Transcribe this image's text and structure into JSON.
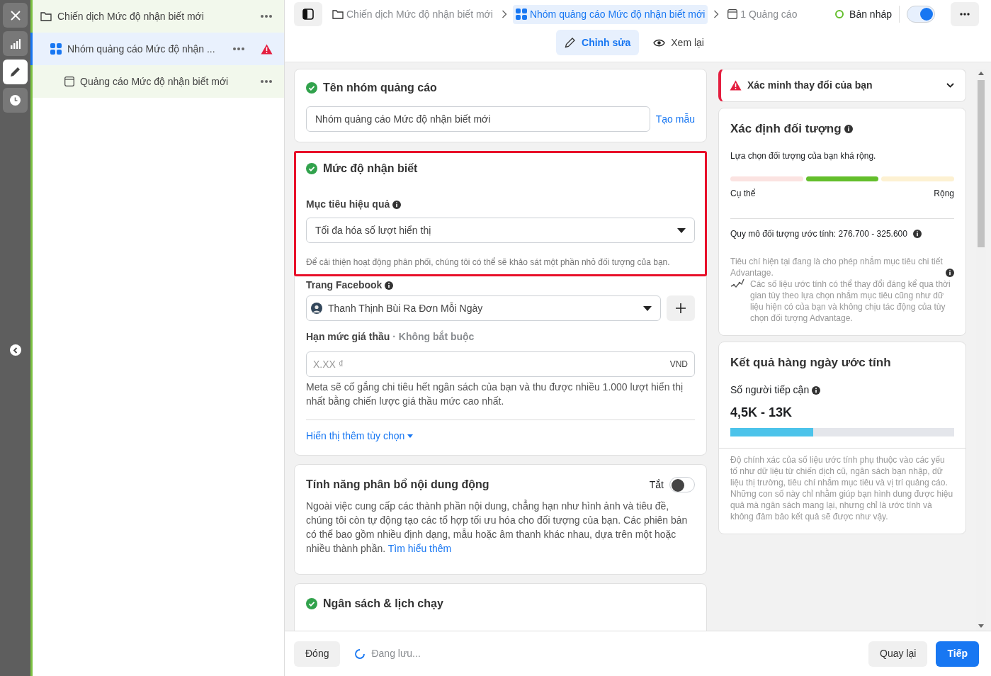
{
  "rail": {
    "buttons": [
      {
        "kind": "close",
        "selected": false
      },
      {
        "kind": "chart",
        "selected": false
      },
      {
        "kind": "edit",
        "selected": true
      },
      {
        "kind": "history",
        "selected": false
      }
    ]
  },
  "tree": [
    {
      "kind": "campaign",
      "label": "Chiến dịch Mức độ nhận biết mới",
      "selected": false,
      "warning": false,
      "children": [
        {
          "kind": "adset",
          "label": "Nhóm quảng cáo Mức độ nhận ...",
          "selected": true,
          "warning": true,
          "children": [
            {
              "kind": "ad",
              "label": "Quảng cáo Mức độ nhận biết mới",
              "selected": false,
              "warning": false
            }
          ]
        }
      ]
    }
  ],
  "breadcrumb": [
    {
      "kind": "campaign",
      "label": "Chiến dịch Mức độ nhận biết mới",
      "selected": false
    },
    {
      "kind": "adset",
      "label": "Nhóm quảng cáo Mức độ nhận biết mới",
      "selected": true
    },
    {
      "kind": "ad",
      "label": "1 Quảng cáo",
      "selected": false
    }
  ],
  "status": {
    "label": "Bản nháp",
    "on": true
  },
  "mode_tabs": [
    {
      "kind": "edit",
      "label": "Chỉnh sửa",
      "selected": true
    },
    {
      "kind": "review",
      "label": "Xem lại",
      "selected": false
    }
  ],
  "adset_name": {
    "title": "Tên nhóm quảng cáo",
    "complete": true,
    "value": "Nhóm quảng cáo Mức độ nhận biết mới",
    "link": "Tạo mẫu"
  },
  "awareness": {
    "title": "Mức độ nhận biết",
    "complete": true,
    "goal_label": "Mục tiêu hiệu quả",
    "goal_value": "Tối đa hóa số lượt hiển thị",
    "note": "Để cải thiện hoạt động phân phối, chúng tôi có thể sẽ khảo sát một phần nhỏ đối tượng của bạn.",
    "page_label": "Trang Facebook",
    "page_value": "Thanh Thịnh Bùi Ra Đơn Mỗi Ngày",
    "bid_label": "Hạn mức giá thầu",
    "bid_optional": "· Không bắt buộc",
    "bid_placeholder": "X.XX ₫",
    "bid_currency": "VND",
    "bid_help": "Meta sẽ cố gắng chi tiêu hết ngân sách của bạn và thu được nhiều 1.000 lượt hiển thị nhất bằng chiến lược giá thầu mức cao nhất.",
    "more_link": "Hiển thị thêm tùy chọn"
  },
  "dynamic_creative": {
    "title": "Tính năng phân bổ nội dung động",
    "state_label": "Tắt",
    "on": false,
    "text": "Ngoài việc cung cấp các thành phần nội dung, chẳng hạn như hình ảnh và tiêu đề, chúng tôi còn tự động tạo các tổ hợp tối ưu hóa cho đối tượng của bạn. Các phiên bản có thể bao gồm nhiều định dạng, mẫu hoặc âm thanh khác nhau, dựa trên một hoặc nhiều thành phần.",
    "link": "Tìm hiểu thêm"
  },
  "budget": {
    "title": "Ngân sách & lịch chạy",
    "complete": true
  },
  "alert": {
    "title": "Xác minh thay đổi của bạn",
    "expanded": false
  },
  "audience": {
    "title": "Xác định đối tượng",
    "summary": "Lựa chọn đối tượng của bạn khá rộng.",
    "segments": [
      {
        "selected": false
      },
      {
        "selected": true
      },
      {
        "selected": false
      }
    ],
    "min_label": "Cụ thể",
    "max_label": "Rộng",
    "size": "Quy mô đối tượng ước tính: 276.700 - 325.600",
    "criteria": "Tiêu chí hiện tại đang là cho phép nhắm mục tiêu chi tiết Advantage.",
    "disclaimer": "Các số liệu ước tính có thể thay đổi đáng kể qua thời gian tùy theo lựa chọn nhắm mục tiêu cũng như dữ liệu hiện có của bạn và không chịu tác động của tùy chọn đối tượng Advantage."
  },
  "results": {
    "title": "Kết quả hàng ngày ước tính",
    "metric_label": "Số người tiếp cận",
    "metric_value": "4,5K - 13K",
    "level": 0.37,
    "disclaimer": "Độ chính xác của số liệu ước tính phụ thuộc vào các yếu tố như dữ liệu từ chiến dịch cũ, ngân sách bạn nhập, dữ liệu thị trường, tiêu chí nhắm mục tiêu và vị trí quảng cáo. Những con số này chỉ nhằm giúp bạn hình dung được hiệu quả mà ngân sách mang lại, nhưng chỉ là ước tính và không đảm bảo kết quả sẽ được như vậy."
  },
  "footer": {
    "close": "Đóng",
    "saving": "Đang lưu...",
    "back": "Quay lại",
    "next": "Tiếp"
  }
}
